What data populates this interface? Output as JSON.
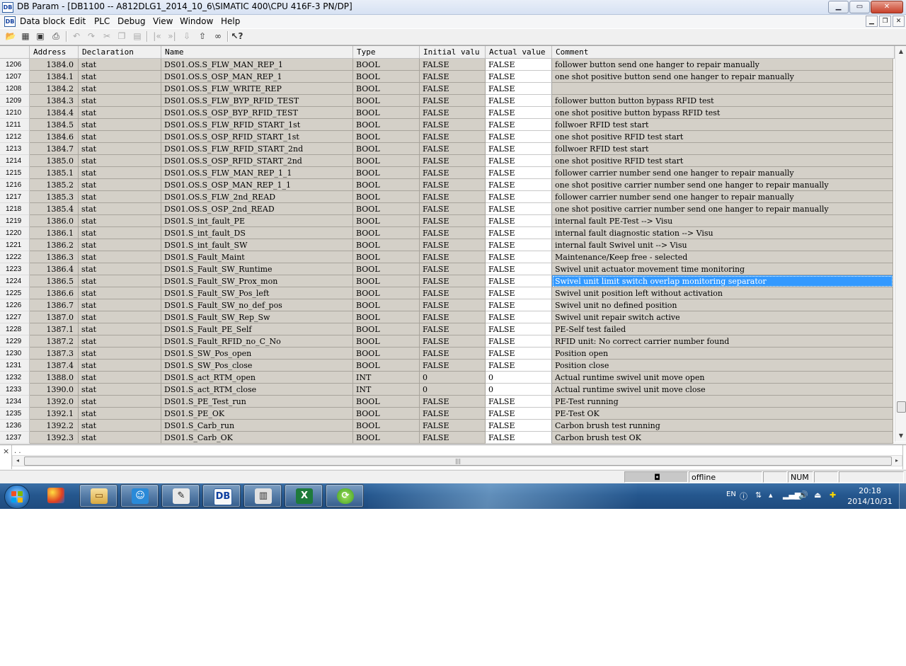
{
  "window": {
    "title": "DB Param - [DB1100 -- A812DLG1_2014_10_6\\SIMATIC 400\\CPU 416F-3 PN/DP]",
    "minimize": "▁",
    "maximize": "▭",
    "close": "✕"
  },
  "menu": {
    "items": [
      "Data block",
      "Edit",
      "PLC",
      "Debug",
      "View",
      "Window",
      "Help"
    ]
  },
  "columns": [
    "",
    "Address",
    "Declaration",
    "Name",
    "Type",
    "Initial valu",
    "Actual value",
    "Comment"
  ],
  "rows": [
    {
      "n": "1206",
      "addr": "1384.0",
      "decl": "stat",
      "name": "DS01.OS.S_FLW_MAN_REP_1",
      "type": "BOOL",
      "init": "FALSE",
      "act": "FALSE",
      "comment": "follower button send one hanger to repair manually"
    },
    {
      "n": "1207",
      "addr": "1384.1",
      "decl": "stat",
      "name": "DS01.OS.S_OSP_MAN_REP_1",
      "type": "BOOL",
      "init": "FALSE",
      "act": "FALSE",
      "comment": "one shot positive button send one hanger to repair manually"
    },
    {
      "n": "1208",
      "addr": "1384.2",
      "decl": "stat",
      "name": "DS01.OS.S_FLW_WRITE_REP",
      "type": "BOOL",
      "init": "FALSE",
      "act": "FALSE",
      "comment": ""
    },
    {
      "n": "1209",
      "addr": "1384.3",
      "decl": "stat",
      "name": "DS01.OS.S_FLW_BYP_RFID_TEST",
      "type": "BOOL",
      "init": "FALSE",
      "act": "FALSE",
      "comment": "follower button button bypass RFID test"
    },
    {
      "n": "1210",
      "addr": "1384.4",
      "decl": "stat",
      "name": "DS01.OS.S_OSP_BYP_RFID_TEST",
      "type": "BOOL",
      "init": "FALSE",
      "act": "FALSE",
      "comment": "one shot positive button bypass RFID test"
    },
    {
      "n": "1211",
      "addr": "1384.5",
      "decl": "stat",
      "name": "DS01.OS.S_FLW_RFID_START_1st",
      "type": "BOOL",
      "init": "FALSE",
      "act": "FALSE",
      "comment": "follwoer RFID test start"
    },
    {
      "n": "1212",
      "addr": "1384.6",
      "decl": "stat",
      "name": "DS01.OS.S_OSP_RFID_START_1st",
      "type": "BOOL",
      "init": "FALSE",
      "act": "FALSE",
      "comment": "one shot positive RFID test start"
    },
    {
      "n": "1213",
      "addr": "1384.7",
      "decl": "stat",
      "name": "DS01.OS.S_FLW_RFID_START_2nd",
      "type": "BOOL",
      "init": "FALSE",
      "act": "FALSE",
      "comment": "follwoer RFID test start"
    },
    {
      "n": "1214",
      "addr": "1385.0",
      "decl": "stat",
      "name": "DS01.OS.S_OSP_RFID_START_2nd",
      "type": "BOOL",
      "init": "FALSE",
      "act": "FALSE",
      "comment": "one shot positive RFID test start"
    },
    {
      "n": "1215",
      "addr": "1385.1",
      "decl": "stat",
      "name": "DS01.OS.S_FLW_MAN_REP_1_1",
      "type": "BOOL",
      "init": "FALSE",
      "act": "FALSE",
      "comment": "follower carrier number send one hanger to repair manually"
    },
    {
      "n": "1216",
      "addr": "1385.2",
      "decl": "stat",
      "name": "DS01.OS.S_OSP_MAN_REP_1_1",
      "type": "BOOL",
      "init": "FALSE",
      "act": "FALSE",
      "comment": "one shot positive carrier number send one hanger to repair manually"
    },
    {
      "n": "1217",
      "addr": "1385.3",
      "decl": "stat",
      "name": "DS01.OS.S_FLW_2nd_READ",
      "type": "BOOL",
      "init": "FALSE",
      "act": "FALSE",
      "comment": "follower carrier number send one hanger to repair manually"
    },
    {
      "n": "1218",
      "addr": "1385.4",
      "decl": "stat",
      "name": "DS01.OS.S_OSP_2nd_READ",
      "type": "BOOL",
      "init": "FALSE",
      "act": "FALSE",
      "comment": "one shot positive carrier number send one hanger to repair manually"
    },
    {
      "n": "1219",
      "addr": "1386.0",
      "decl": "stat",
      "name": "DS01.S_int_fault_PE",
      "type": "BOOL",
      "init": "FALSE",
      "act": "FALSE",
      "comment": "internal fault PE-Test --> Visu"
    },
    {
      "n": "1220",
      "addr": "1386.1",
      "decl": "stat",
      "name": "DS01.S_int_fault_DS",
      "type": "BOOL",
      "init": "FALSE",
      "act": "FALSE",
      "comment": "internal fault diagnostic station --> Visu"
    },
    {
      "n": "1221",
      "addr": "1386.2",
      "decl": "stat",
      "name": "DS01.S_int_fault_SW",
      "type": "BOOL",
      "init": "FALSE",
      "act": "FALSE",
      "comment": "internal fault Swivel unit --> Visu"
    },
    {
      "n": "1222",
      "addr": "1386.3",
      "decl": "stat",
      "name": "DS01.S_Fault_Maint",
      "type": "BOOL",
      "init": "FALSE",
      "act": "FALSE",
      "comment": "Maintenance/Keep free - selected"
    },
    {
      "n": "1223",
      "addr": "1386.4",
      "decl": "stat",
      "name": "DS01.S_Fault_SW_Runtime",
      "type": "BOOL",
      "init": "FALSE",
      "act": "FALSE",
      "comment": "Swivel unit actuator movement time monitoring"
    },
    {
      "n": "1224",
      "addr": "1386.5",
      "decl": "stat",
      "name": "DS01.S_Fault_SW_Prox_mon",
      "type": "BOOL",
      "init": "FALSE",
      "act": "FALSE",
      "comment": "Swivel unit limit switch overlap monitoring separator",
      "selected": true
    },
    {
      "n": "1225",
      "addr": "1386.6",
      "decl": "stat",
      "name": "DS01.S_Fault_SW_Pos_left",
      "type": "BOOL",
      "init": "FALSE",
      "act": "FALSE",
      "comment": "Swivel unit position left without activation"
    },
    {
      "n": "1226",
      "addr": "1386.7",
      "decl": "stat",
      "name": "DS01.S_Fault_SW_no_def_pos",
      "type": "BOOL",
      "init": "FALSE",
      "act": "FALSE",
      "comment": "Swivel unit no defined position"
    },
    {
      "n": "1227",
      "addr": "1387.0",
      "decl": "stat",
      "name": "DS01.S_Fault_SW_Rep_Sw",
      "type": "BOOL",
      "init": "FALSE",
      "act": "FALSE",
      "comment": "Swivel unit repair switch active"
    },
    {
      "n": "1228",
      "addr": "1387.1",
      "decl": "stat",
      "name": "DS01.S_Fault_PE_Self",
      "type": "BOOL",
      "init": "FALSE",
      "act": "FALSE",
      "comment": "PE-Self test failed"
    },
    {
      "n": "1229",
      "addr": "1387.2",
      "decl": "stat",
      "name": "DS01.S_Fault_RFID_no_C_No",
      "type": "BOOL",
      "init": "FALSE",
      "act": "FALSE",
      "comment": "RFID unit: No correct carrier number found"
    },
    {
      "n": "1230",
      "addr": "1387.3",
      "decl": "stat",
      "name": "DS01.S_SW_Pos_open",
      "type": "BOOL",
      "init": "FALSE",
      "act": "FALSE",
      "comment": "Position open"
    },
    {
      "n": "1231",
      "addr": "1387.4",
      "decl": "stat",
      "name": "DS01.S_SW_Pos_close",
      "type": "BOOL",
      "init": "FALSE",
      "act": "FALSE",
      "comment": "Position close"
    },
    {
      "n": "1232",
      "addr": "1388.0",
      "decl": "stat",
      "name": "DS01.S_act_RTM_open",
      "type": "INT",
      "init": "0",
      "act": "0",
      "comment": "Actual runtime swivel unit move open"
    },
    {
      "n": "1233",
      "addr": "1390.0",
      "decl": "stat",
      "name": "DS01.S_act_RTM_close",
      "type": "INT",
      "init": "0",
      "act": "0",
      "comment": "Actual runtime swivel unit move close"
    },
    {
      "n": "1234",
      "addr": "1392.0",
      "decl": "stat",
      "name": "DS01.S_PE_Test_run",
      "type": "BOOL",
      "init": "FALSE",
      "act": "FALSE",
      "comment": "PE-Test running"
    },
    {
      "n": "1235",
      "addr": "1392.1",
      "decl": "stat",
      "name": "DS01.S_PE_OK",
      "type": "BOOL",
      "init": "FALSE",
      "act": "FALSE",
      "comment": "PE-Test OK"
    },
    {
      "n": "1236",
      "addr": "1392.2",
      "decl": "stat",
      "name": "DS01.S_Carb_run",
      "type": "BOOL",
      "init": "FALSE",
      "act": "FALSE",
      "comment": "Carbon brush test running"
    },
    {
      "n": "1237",
      "addr": "1392.3",
      "decl": "stat",
      "name": "DS01.S_Carb_OK",
      "type": "BOOL",
      "init": "FALSE",
      "act": "FALSE",
      "comment": "Carbon brush test OK"
    }
  ],
  "lower_pane": {
    "close": "×",
    "text": ". ."
  },
  "status": {
    "mode": "offline",
    "num": "NUM"
  },
  "taskbar": {
    "lang": "EN",
    "time": "20:18",
    "date": "2014/10/31"
  },
  "colors": {
    "grid_bg": "#d4d0c8",
    "actual_bg": "#ffffff",
    "selection": "#3399ff",
    "taskbar": "#25578e"
  }
}
